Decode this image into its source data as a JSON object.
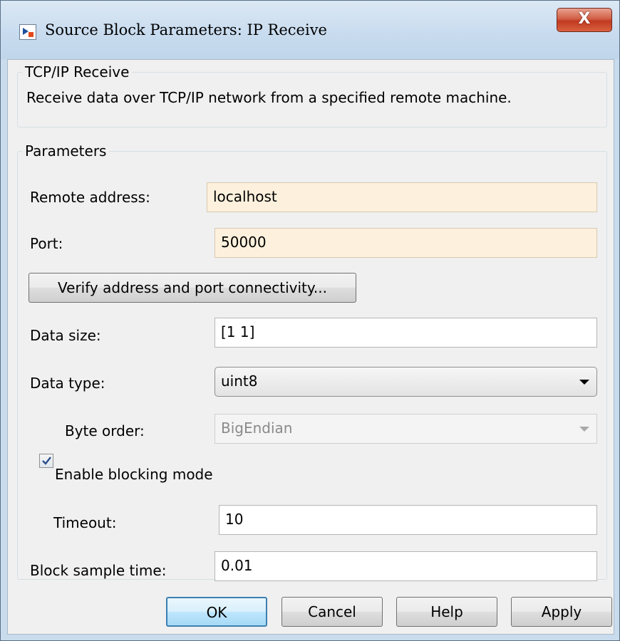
{
  "window": {
    "title": "Source Block Parameters: IP Receive",
    "close_label": "X"
  },
  "description_group": {
    "title": "TCP/IP Receive",
    "text": "Receive data over TCP/IP network from a specified remote machine."
  },
  "parameters": {
    "title": "Parameters",
    "remote_address": {
      "label": "Remote address:",
      "value": "localhost"
    },
    "port": {
      "label": "Port:",
      "value": "50000"
    },
    "verify_button": "Verify address and port connectivity...",
    "data_size": {
      "label": "Data size:",
      "value": "[1 1]"
    },
    "data_type": {
      "label": "Data type:",
      "value": "uint8"
    },
    "byte_order": {
      "label": "Byte order:",
      "value": "BigEndian",
      "enabled": false
    },
    "blocking_mode": {
      "label": "Enable blocking mode",
      "checked": true
    },
    "timeout": {
      "label": "Timeout:",
      "value": "10"
    },
    "sample_time": {
      "label": "Block sample time:",
      "value": "0.01"
    }
  },
  "buttons": {
    "ok": "OK",
    "cancel": "Cancel",
    "help": "Help",
    "apply": "Apply"
  },
  "colors": {
    "highlighted_field": "#fdf1dd",
    "default_button_border": "#3c7fb1",
    "close_button": "#c13a21"
  }
}
